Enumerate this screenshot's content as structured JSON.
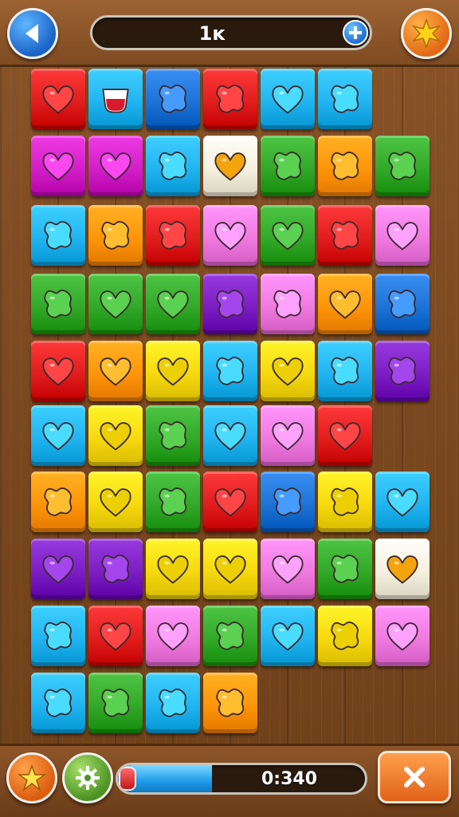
{
  "header": {
    "score": "1ĸ",
    "back_icon": "back-arrow-icon",
    "plus_icon": "plus-icon",
    "bonus_icon": "star-burst-icon"
  },
  "footer": {
    "timer_text": "0:340",
    "timer_fraction": 0.38,
    "hint_icon": "lightning-star-icon",
    "settings_icon": "gear-icon",
    "close_icon": "close-x-icon"
  },
  "palette": {
    "red": "#e11d1d",
    "magenta": "#d21fc8",
    "blue": "#1e73d6",
    "cyan": "#22b4f0",
    "green": "#32a928",
    "yellow": "#f6d90e",
    "orange": "#ff9508",
    "pink": "#f07ae0",
    "purple": "#7b1fc4",
    "cream": "#f6f0de"
  },
  "grid": [
    [
      [
        "red",
        "heart"
      ],
      [
        "cyan",
        "cup"
      ],
      [
        "blue",
        "blob"
      ],
      [
        "red",
        "blob"
      ],
      [
        "cyan",
        "heart"
      ],
      [
        "cyan",
        "blob"
      ]
    ],
    [
      [
        "magenta",
        "heart"
      ],
      [
        "magenta",
        "heart"
      ],
      [
        "cyan",
        "blob"
      ],
      [
        "cream",
        "heart"
      ],
      [
        "green",
        "blob"
      ],
      [
        "orange",
        "blob"
      ],
      [
        "green",
        "blob"
      ]
    ],
    [
      [
        "cyan",
        "blob"
      ],
      [
        "orange",
        "blob"
      ],
      [
        "red",
        "blob"
      ],
      [
        "pink",
        "heart"
      ],
      [
        "green",
        "heart"
      ],
      [
        "red",
        "blob"
      ],
      [
        "pink",
        "heart"
      ]
    ],
    [
      [
        "green",
        "blob"
      ],
      [
        "green",
        "heart"
      ],
      [
        "green",
        "heart"
      ],
      [
        "purple",
        "blob"
      ],
      [
        "pink",
        "blob"
      ],
      [
        "orange",
        "heart"
      ],
      [
        "blue",
        "blob"
      ]
    ],
    [
      [
        "red",
        "heart"
      ],
      [
        "orange",
        "heart"
      ],
      [
        "yellow",
        "heart"
      ],
      [
        "cyan",
        "blob"
      ],
      [
        "yellow",
        "heart"
      ],
      [
        "cyan",
        "blob"
      ],
      [
        "purple",
        "blob"
      ]
    ],
    [
      [
        "cyan",
        "heart"
      ],
      [
        "yellow",
        "heart"
      ],
      [
        "green",
        "blob"
      ],
      [
        "cyan",
        "heart"
      ],
      [
        "pink",
        "heart"
      ],
      [
        "red",
        "heart"
      ]
    ],
    [
      [
        "orange",
        "blob"
      ],
      [
        "yellow",
        "heart"
      ],
      [
        "green",
        "blob"
      ],
      [
        "red",
        "heart"
      ],
      [
        "blue",
        "blob"
      ],
      [
        "yellow",
        "blob"
      ],
      [
        "cyan",
        "heart"
      ]
    ],
    [
      [
        "purple",
        "heart"
      ],
      [
        "purple",
        "blob"
      ],
      [
        "yellow",
        "heart"
      ],
      [
        "yellow",
        "heart"
      ],
      [
        "pink",
        "heart"
      ],
      [
        "green",
        "blob"
      ],
      [
        "cream",
        "heart"
      ]
    ],
    [
      [
        "cyan",
        "blob"
      ],
      [
        "red",
        "heart"
      ],
      [
        "pink",
        "heart"
      ],
      [
        "green",
        "blob"
      ],
      [
        "cyan",
        "heart"
      ],
      [
        "yellow",
        "blob"
      ],
      [
        "pink",
        "heart"
      ]
    ],
    [
      [
        "cyan",
        "blob"
      ],
      [
        "green",
        "blob"
      ],
      [
        "cyan",
        "blob"
      ],
      [
        "orange",
        "blob"
      ]
    ]
  ]
}
